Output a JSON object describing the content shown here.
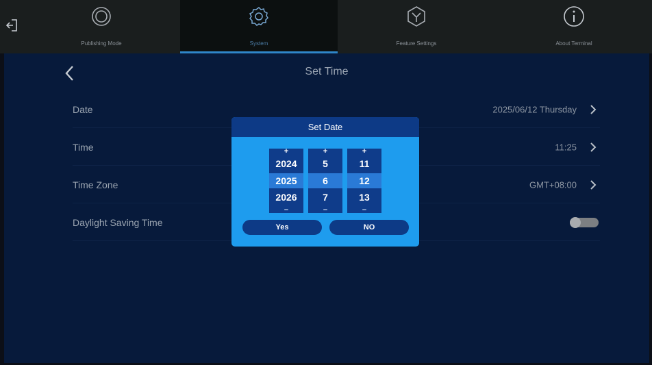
{
  "nav": {
    "tabs": [
      {
        "label": "Publishing Mode",
        "icon": "publishing-mode-icon",
        "active": false
      },
      {
        "label": "System",
        "icon": "gear-icon",
        "active": true
      },
      {
        "label": "Feature Settings",
        "icon": "feature-settings-icon",
        "active": false
      },
      {
        "label": "About Terminal",
        "icon": "info-icon",
        "active": false
      }
    ],
    "exit_icon": "exit-icon"
  },
  "page": {
    "title": "Set Time",
    "back_icon": "chevron-left-icon"
  },
  "settings": {
    "rows": [
      {
        "label": "Date",
        "value": "2025/06/12  Thursday"
      },
      {
        "label": "Time",
        "value": "11:25"
      },
      {
        "label": "Time Zone",
        "value": "GMT+08:00"
      },
      {
        "label": "Daylight Saving Time",
        "toggle": false
      }
    ]
  },
  "dialog": {
    "title": "Set Date",
    "plus": "+",
    "minus": "−",
    "year": {
      "prev": "2024",
      "current": "2025",
      "next": "2026"
    },
    "month": {
      "prev": "5",
      "current": "6",
      "next": "7"
    },
    "day": {
      "prev": "11",
      "current": "12",
      "next": "13"
    },
    "yes_label": "Yes",
    "no_label": "NO"
  },
  "colors": {
    "accent": "#2f86c9",
    "panel": "#071a3b",
    "dialog": "#1e9cee",
    "dialog_dark": "#0d3a86"
  }
}
